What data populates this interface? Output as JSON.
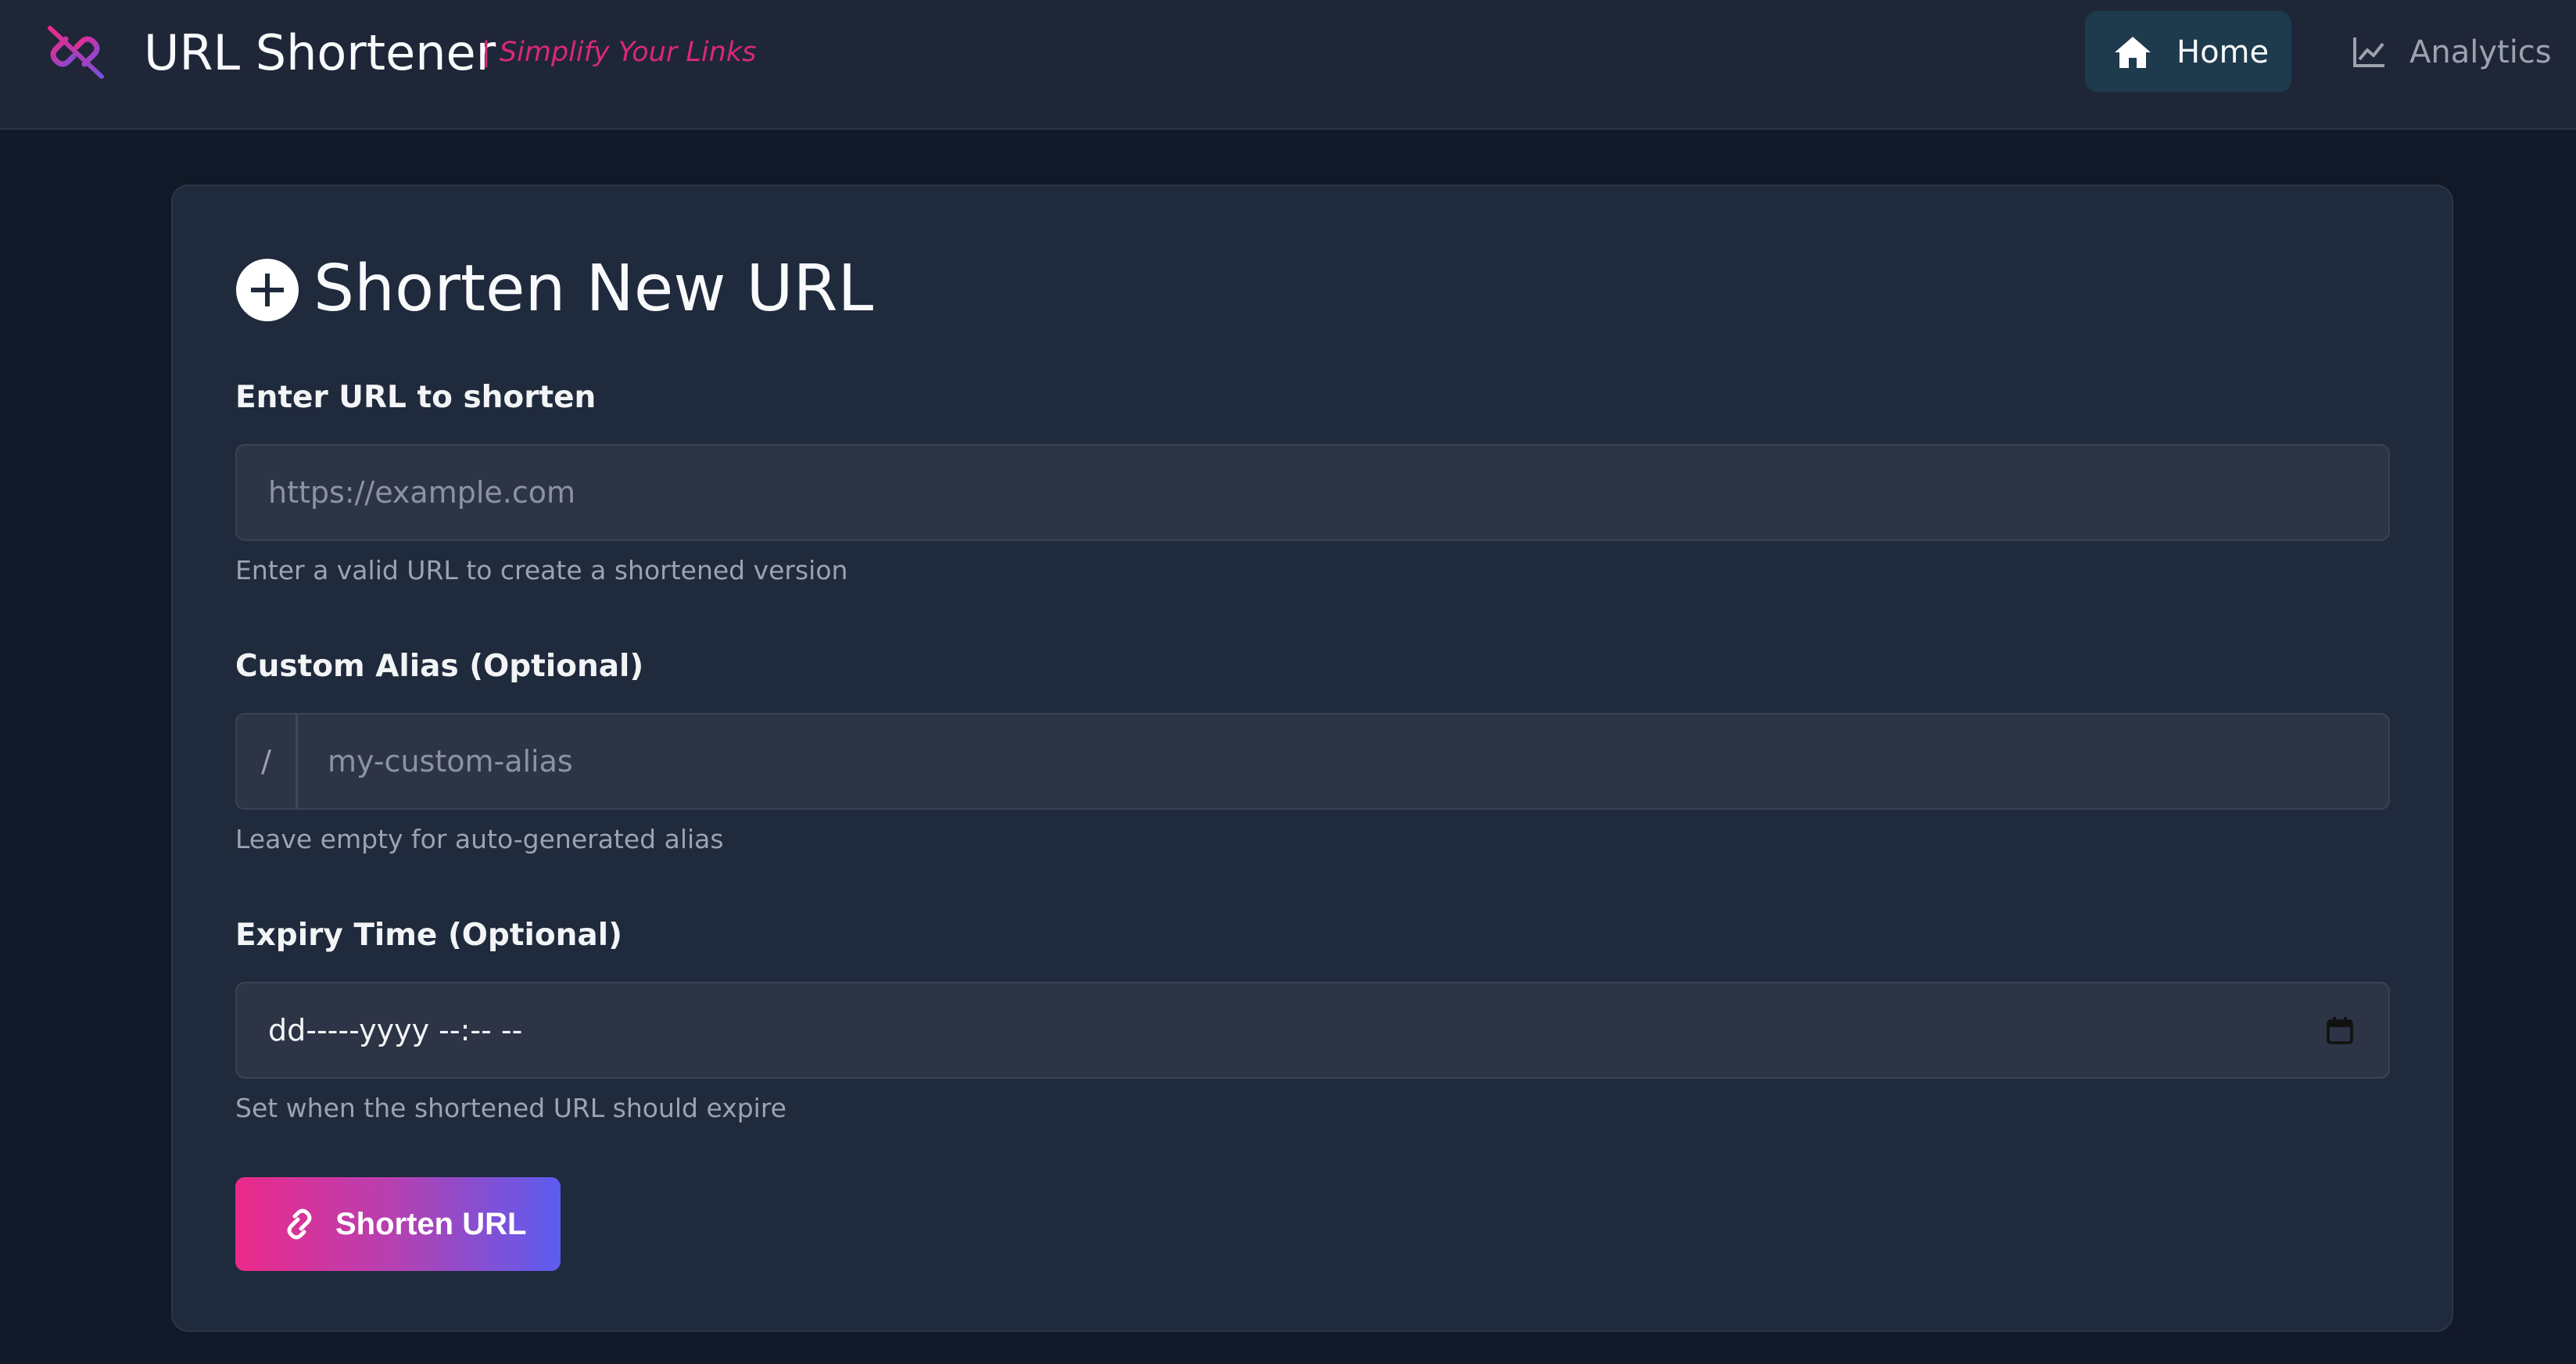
{
  "header": {
    "brand_title": "URL Shortener",
    "tagline": "| Simplify Your Links",
    "nav": [
      {
        "label": "Home",
        "icon": "home-icon",
        "active": true
      },
      {
        "label": "Analytics",
        "icon": "chart-line-icon",
        "active": false
      }
    ]
  },
  "card": {
    "title": "Shorten New URL",
    "title_icon": "plus-circle-icon",
    "url_field": {
      "label": "Enter URL to shorten",
      "placeholder": "https://example.com",
      "help": "Enter a valid URL to create a shortened version"
    },
    "alias_field": {
      "label": "Custom Alias (Optional)",
      "prefix": "/",
      "placeholder": "my-custom-alias",
      "help": "Leave empty for auto-generated alias"
    },
    "expiry_field": {
      "label": "Expiry Time (Optional)",
      "value_display": "dd-----yyyy --:-- --",
      "help": "Set when the shortened URL should expire"
    },
    "submit_label": "Shorten URL"
  },
  "colors": {
    "background": "#111827",
    "topbar": "#1f2637",
    "card": "#1f2a3c",
    "input": "#2d3446",
    "accent_pink": "#ec2a8a",
    "accent_blue": "#5b5cf0",
    "tagline": "#db2777",
    "home_active": "#1e3a4d"
  }
}
